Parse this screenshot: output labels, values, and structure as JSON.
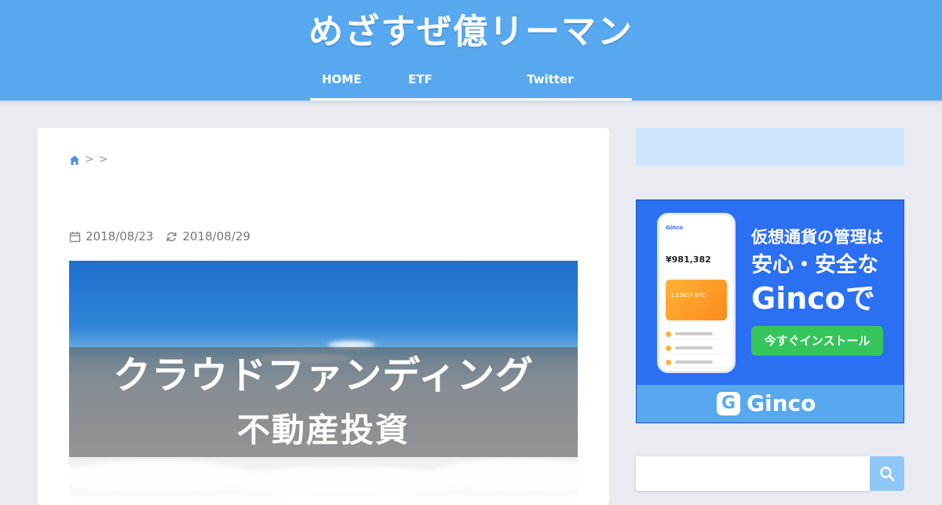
{
  "header": {
    "site_title": "めざすぜ億リーマン",
    "nav": [
      {
        "label": "HOME"
      },
      {
        "label": "ETF"
      },
      {
        "label": "Twitter"
      }
    ]
  },
  "breadcrumb": {
    "home_icon": "home-icon",
    "separators": [
      ">",
      ">"
    ]
  },
  "post": {
    "published_date": "2018/08/23",
    "updated_date": "2018/08/29",
    "eyecatch": {
      "title": "クラウドファンディング",
      "subtitle": "不動産投資"
    }
  },
  "sidebar": {
    "ad": {
      "headline_line1": "仮想通貨の管理は",
      "headline_line2": "安心・安全な",
      "headline_line3": "Gincoで",
      "cta_label": "今すぐインストール",
      "brand": "Ginco",
      "brand_mark": "G",
      "phone": {
        "app_name": "Ginco",
        "balance": "¥981,382",
        "btc_amount": "1.23657 BTC"
      }
    },
    "search": {
      "placeholder": "",
      "icon": "search-icon"
    }
  },
  "colors": {
    "header_bg": "#58a8ef",
    "page_bg": "#e9ebf0",
    "accent_blue": "#2b6ff3",
    "cta_green": "#35c55a",
    "sidebar_box": "#cde5fd"
  }
}
